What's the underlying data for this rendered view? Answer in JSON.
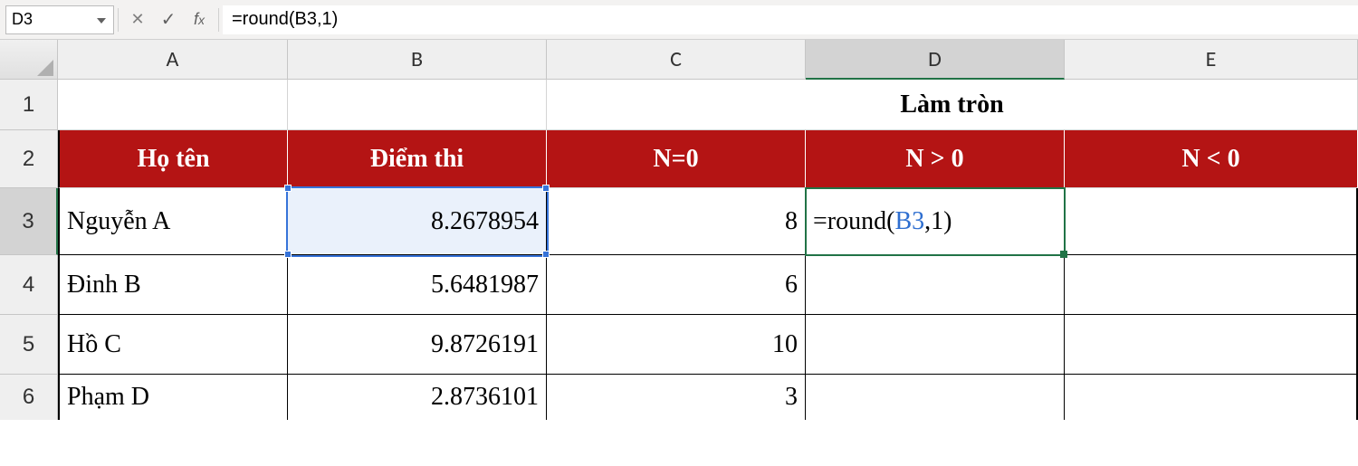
{
  "nameBox": "D3",
  "formulaBar": "=round(B3,1)",
  "columns": [
    "A",
    "B",
    "C",
    "D",
    "E"
  ],
  "rowNumbers": [
    "1",
    "2",
    "3",
    "4",
    "5",
    "6"
  ],
  "mergedTitle": "Làm tròn",
  "headers": {
    "A": "Họ tên",
    "B": "Điểm thi",
    "C": "N=0",
    "D": "N > 0",
    "E": "N < 0"
  },
  "rows": [
    {
      "name": "Nguyễn A",
      "score": "8.2678954",
      "n0": "8"
    },
    {
      "name": "Đinh B",
      "score": "5.6481987",
      "n0": "6"
    },
    {
      "name": "Hồ C",
      "score": "9.8726191",
      "n0": "10"
    },
    {
      "name": "Phạm D",
      "score": "2.8736101",
      "n0": "3"
    }
  ],
  "editingCell": {
    "prefix": "=round(",
    "ref": "B3",
    "suffix": ",1)"
  }
}
